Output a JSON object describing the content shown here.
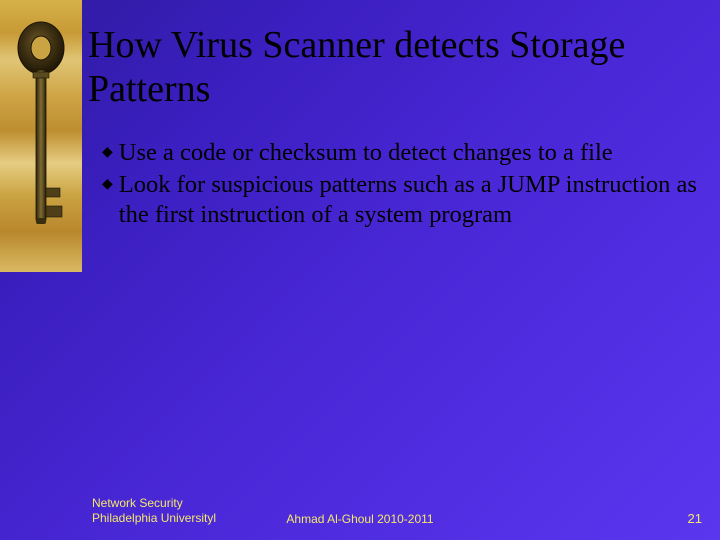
{
  "title": "How Virus Scanner detects Storage Patterns",
  "bullets": [
    "Use a code or checksum to detect changes to a file",
    "Look for suspicious patterns such as a JUMP instruction as the first instruction of a system program"
  ],
  "footer": {
    "left_line1": "Network Security",
    "left_line2": "Philadelphia Universityl",
    "center": "Ahmad Al-Ghoul 2010-2011",
    "page": "21"
  }
}
